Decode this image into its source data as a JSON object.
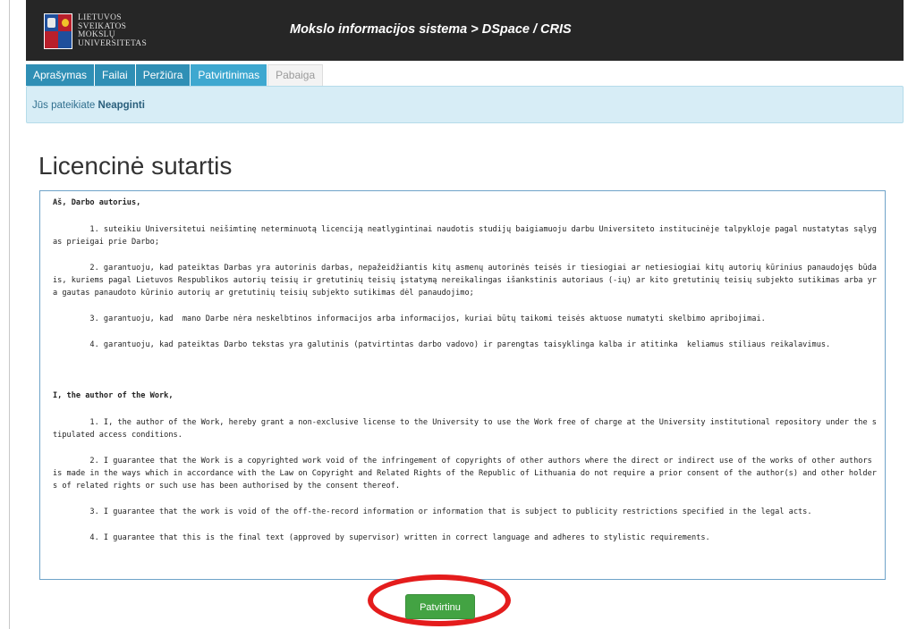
{
  "header": {
    "logo_lines": [
      "LIETUVOS",
      "SVEIKATOS",
      "MOKSLŲ",
      "UNIVERSITETAS"
    ],
    "title": "Mokslo informacijos sistema > DSpace / CRIS"
  },
  "tabs": [
    {
      "label": "Aprašymas",
      "state": "done"
    },
    {
      "label": "Failai",
      "state": "done"
    },
    {
      "label": "Peržiūra",
      "state": "done"
    },
    {
      "label": "Patvirtinimas",
      "state": "active"
    },
    {
      "label": "Pabaiga",
      "state": "disabled"
    }
  ],
  "info": {
    "prefix": "Jūs pateikiate",
    "value": "Neapginti"
  },
  "page_title": "Licencinė sutartis",
  "license": {
    "lt_header": "Aš, Darbo autorius,",
    "lt_items": [
      "        1. suteikiu Universitetui neišimtinę neterminuotą licenciją neatlygintinai naudotis studijų baigiamuoju darbu Universiteto institucinėje talpykloje pagal nustatytas sąlygas prieigai prie Darbo;",
      "        2. garantuoju, kad pateiktas Darbas yra autorinis darbas, nepažeidžiantis kitų asmenų autorinės teisės ir tiesiogiai ar netiesiogiai kitų autorių kūrinius panaudojęs būdais, kuriems pagal Lietuvos Respublikos autorių teisių ir gretutinių teisių įstatymą nereikalingas išankstinis autoriaus (-ių) ar kito gretutinių teisių subjekto sutikimas arba yra gautas panaudoto kūrinio autorių ar gretutinių teisių subjekto sutikimas dėl panaudojimo;",
      "        3. garantuoju, kad  mano Darbe nėra neskelbtinos informacijos arba informacijos, kuriai būtų taikomi teisės aktuose numatyti skelbimo apribojimai.",
      "        4. garantuoju, kad pateiktas Darbo tekstas yra galutinis (patvirtintas darbo vadovo) ir parengtas taisyklinga kalba ir atitinka  keliamus stiliaus reikalavimus."
    ],
    "en_header": "I, the author of the Work,",
    "en_items": [
      "        1. I, the author of the Work, hereby grant a non-exclusive license to the University to use the Work free of charge at the University institutional repository under the stipulated access conditions.",
      "        2. I guarantee that the Work is a copyrighted work void of the infringement of copyrights of other authors where the direct or indirect use of the works of other authors is made in the ways which in accordance with the Law on Copyright and Related Rights of the Republic of Lithuania do not require a prior consent of the author(s) and other holders of related rights or such use has been authorised by the consent thereof.",
      "        3. I guarantee that the work is void of the off-the-record information or information that is subject to publicity restrictions specified in the legal acts.",
      "        4. I guarantee that this is the final text (approved by supervisor) written in correct language and adheres to stylistic requirements."
    ]
  },
  "confirm_button": "Patvirtinu",
  "colors": {
    "header_bg": "#262626",
    "tab_done": "#2f8fb5",
    "tab_active": "#3ea8d0",
    "info_bg": "#d7edf6",
    "button": "#43a343",
    "annotation": "#e41c1c"
  }
}
